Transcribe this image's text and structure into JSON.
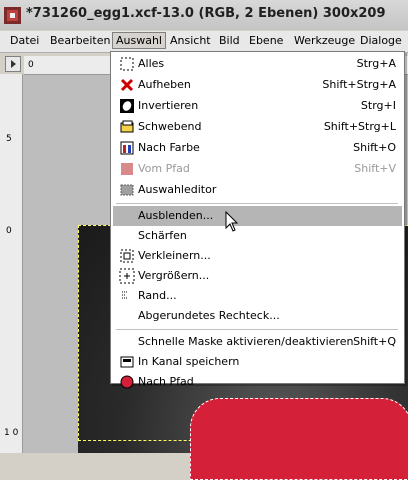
{
  "window": {
    "title": "*731260_egg1.xcf-13.0 (RGB, 2 Ebenen) 300x209"
  },
  "menubar": [
    "Datei",
    "Bearbeiten",
    "Auswahl",
    "Ansicht",
    "Bild",
    "Ebene",
    "Werkzeuge",
    "Dialoge"
  ],
  "rulers": {
    "h0": "0",
    "v0": "0",
    "v5": "5",
    "v10": "1 0"
  },
  "menu": {
    "items": [
      {
        "label": "Alles",
        "shortcut": "Strg+A",
        "icon": "select-all-icon"
      },
      {
        "label": "Aufheben",
        "shortcut": "Shift+Strg+A",
        "icon": "select-none-icon"
      },
      {
        "label": "Invertieren",
        "shortcut": "Strg+I",
        "icon": "invert-selection-icon"
      },
      {
        "label": "Schwebend",
        "shortcut": "Shift+Strg+L",
        "icon": "float-selection-icon"
      },
      {
        "label": "Nach Farbe",
        "shortcut": "Shift+O",
        "icon": "select-by-color-icon"
      },
      {
        "label": "Vom Pfad",
        "shortcut": "Shift+V",
        "icon": "from-path-icon",
        "disabled": true
      },
      {
        "label": "Auswahleditor",
        "shortcut": "",
        "icon": "selection-editor-icon"
      },
      {
        "label": "Ausblenden...",
        "shortcut": "",
        "icon": "",
        "highlighted": true
      },
      {
        "label": "Schärfen",
        "shortcut": "",
        "icon": ""
      },
      {
        "label": "Verkleinern...",
        "shortcut": "",
        "icon": "shrink-icon"
      },
      {
        "label": "Vergrößern...",
        "shortcut": "",
        "icon": "grow-icon"
      },
      {
        "label": "Rand...",
        "shortcut": "",
        "icon": "border-icon"
      },
      {
        "label": "Abgerundetes Rechteck...",
        "shortcut": "",
        "icon": ""
      },
      {
        "label": "Schnelle Maske aktivieren/deaktivieren",
        "shortcut": "Shift+Q",
        "icon": ""
      },
      {
        "label": "In Kanal speichern",
        "shortcut": "",
        "icon": "save-to-channel-icon"
      },
      {
        "label": "Nach Pfad",
        "shortcut": "",
        "icon": "to-path-icon"
      }
    ]
  }
}
